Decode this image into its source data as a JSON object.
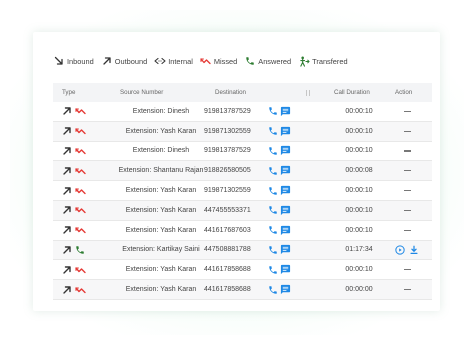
{
  "legend": [
    {
      "label": "Inbound",
      "icon": "inbound-arrow-icon"
    },
    {
      "label": "Outbound",
      "icon": "outbound-arrow-icon"
    },
    {
      "label": "Internal",
      "icon": "internal-arrows-icon"
    },
    {
      "label": "Missed",
      "icon": "missed-call-icon"
    },
    {
      "label": "Answered",
      "icon": "answered-call-icon"
    },
    {
      "label": "Transfered",
      "icon": "transfer-person-icon"
    }
  ],
  "columns": {
    "type": "Type",
    "source": "Source Number",
    "destination": "Destination",
    "duration": "Call Duration",
    "action": "Action"
  },
  "colors": {
    "missed": "#e53935",
    "answered": "#2e7d32",
    "accent": "#1e88e5",
    "arrow": "#333333"
  },
  "rows": [
    {
      "direction": "outbound",
      "status": "missed",
      "source": "Extension: Dinesh",
      "destination": "919813787529",
      "duration": "00:00:10",
      "action": "—"
    },
    {
      "direction": "outbound",
      "status": "missed",
      "source": "Extension: Yash Karan",
      "destination": "919871302559",
      "duration": "00:00:10",
      "action": "—"
    },
    {
      "direction": "outbound",
      "status": "missed",
      "source": "Extension: Dinesh",
      "destination": "919813787529",
      "duration": "00:00:10",
      "action": "—"
    },
    {
      "direction": "outbound",
      "status": "missed",
      "source": "Extension: Shantanu Rajan",
      "destination": "918826580505",
      "duration": "00:00:08",
      "action": "—"
    },
    {
      "direction": "outbound",
      "status": "missed",
      "source": "Extension: Yash Karan",
      "destination": "919871302559",
      "duration": "00:00:10",
      "action": "—"
    },
    {
      "direction": "outbound",
      "status": "missed",
      "source": "Extension: Yash Karan",
      "destination": "447455553371",
      "duration": "00:00:10",
      "action": "—"
    },
    {
      "direction": "outbound",
      "status": "missed",
      "source": "Extension: Yash Karan",
      "destination": "441617687603",
      "duration": "00:00:10",
      "action": "—"
    },
    {
      "direction": "outbound",
      "status": "answered",
      "source": "Extension: Kartikay Saini",
      "destination": "447508881788",
      "duration": "01:17:34",
      "action": "play-download"
    },
    {
      "direction": "outbound",
      "status": "missed",
      "source": "Extension: Yash Karan",
      "destination": "441617858688",
      "duration": "00:00:10",
      "action": "—"
    },
    {
      "direction": "outbound",
      "status": "missed",
      "source": "Extension: Yash Karan",
      "destination": "441617858688",
      "duration": "00:00:00",
      "action": "—"
    }
  ]
}
